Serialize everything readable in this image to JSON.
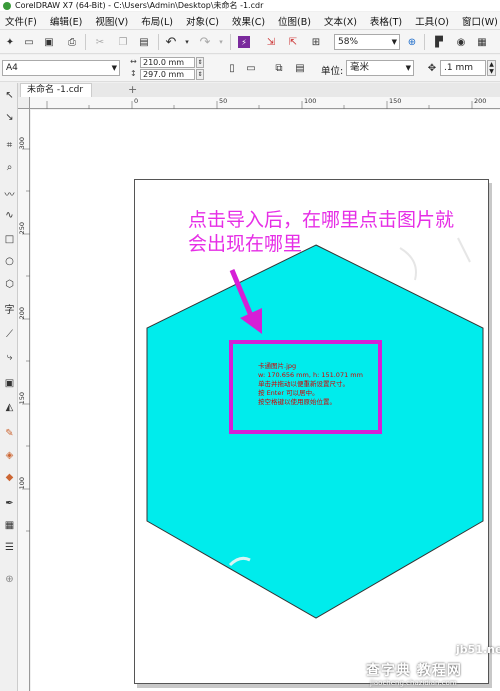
{
  "window": {
    "title": "CorelDRAW X7 (64-Bit) - C:\\Users\\Admin\\Desktop\\未命名 -1.cdr"
  },
  "menu": {
    "items": [
      "文件(F)",
      "编辑(E)",
      "视图(V)",
      "布局(L)",
      "对象(C)",
      "效果(C)",
      "位图(B)",
      "文本(X)",
      "表格(T)",
      "工具(O)",
      "窗口(W)"
    ]
  },
  "toolbar": {
    "zoom_value": "58%"
  },
  "property_bar": {
    "page_size": "A4",
    "width": "210.0 mm",
    "height": "297.0 mm",
    "unit_label": "单位:",
    "unit_value": "毫米",
    "nudge_value": ".1 mm"
  },
  "document": {
    "tab_label": "未命名 -1.cdr",
    "add_tab": "+"
  },
  "ruler": {
    "top_ticks": [
      "0",
      "50",
      "100",
      "150",
      "200"
    ],
    "left_ticks": [
      "300",
      "250",
      "200",
      "150",
      "100"
    ]
  },
  "annotation": {
    "line1": "点击导入后，在哪里点击图片就",
    "line2": "会出现在哪里",
    "color": "#e62ee6"
  },
  "import_info": {
    "filename": "卡通图片.jpg",
    "size": "w: 170.656 mm, h: 151.071 mm",
    "hint1": "单击并拖动以便重新设置尺寸。",
    "hint2": "按 Enter 可以居中。",
    "hint3": "按空格键以使用原始位置。"
  },
  "shape": {
    "fill": "#00ecec"
  },
  "watermark": {
    "url": "jb51.net",
    "brand": "查字典 教程网",
    "sub": "jiaocheng.chazidian.com"
  }
}
